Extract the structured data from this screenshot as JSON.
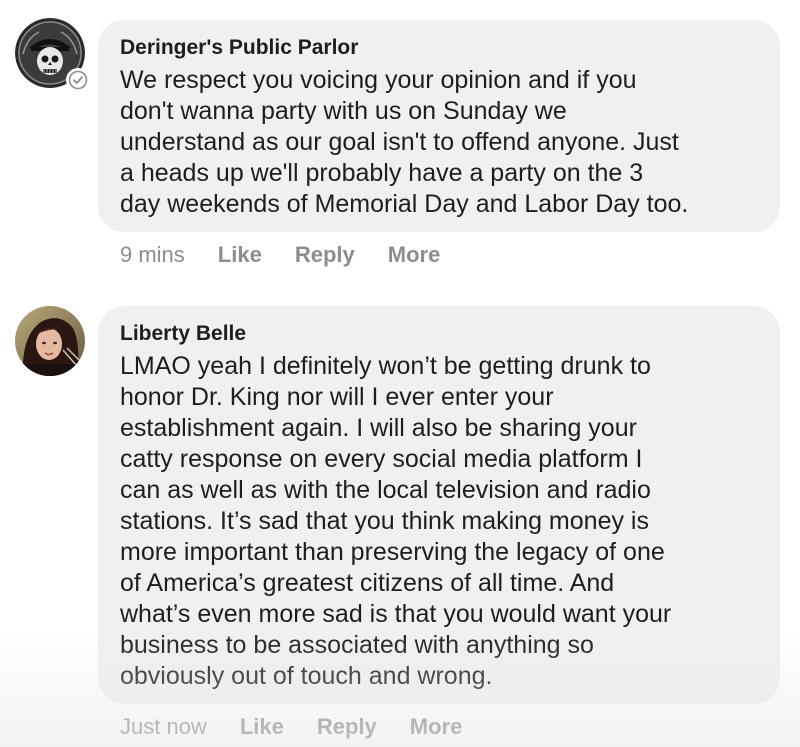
{
  "comments": [
    {
      "author": "Deringer's Public Parlor",
      "text": "We respect you voicing your opinion and if you\ndon't wanna party with us on Sunday we\nunderstand as our goal isn't to offend anyone. Just\na heads up we'll probably have a party on the 3\nday weekends of Memorial Day and Labor Day too.",
      "time": "9 mins",
      "like": "Like",
      "reply": "Reply",
      "more": "More",
      "verified": true
    },
    {
      "author": "Liberty Belle",
      "text": "LMAO yeah I definitely won’t be getting drunk to\nhonor Dr. King nor will I ever enter your\nestablishment again. I will also be sharing your\ncatty response on every social media platform I\ncan as well as with the local television and radio\nstations. It’s sad that you think making money is\nmore important than preserving the legacy of one\nof America’s greatest citizens of all time. And\nwhat’s even more sad is that you would want your\nbusiness to be associated with anything so\nobviously out of touch and wrong.",
      "time": "Just now",
      "like": "Like",
      "reply": "Reply",
      "more": "More",
      "verified": false
    }
  ],
  "icons": {
    "avatar_1": "skull-cowboy-logo",
    "avatar_2": "profile-photo",
    "verified": "checkmark-badge-icon"
  }
}
